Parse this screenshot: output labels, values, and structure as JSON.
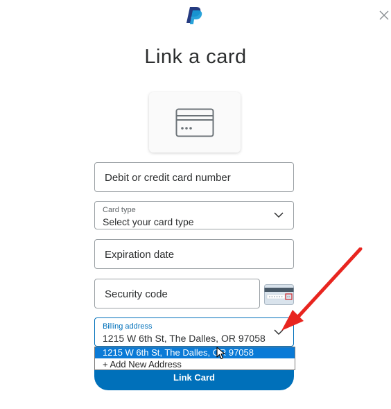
{
  "header": {
    "title": "Link a card",
    "logo_icon": "paypal-logo",
    "close_icon": "close-icon"
  },
  "card_tile": {
    "icon": "credit-card-icon"
  },
  "form": {
    "card_number": {
      "placeholder": "Debit or credit card number"
    },
    "card_type": {
      "label": "Card type",
      "value": "Select your card type"
    },
    "expiration": {
      "placeholder": "Expiration date"
    },
    "security": {
      "placeholder": "Security code",
      "helper_icon": "card-back-cvv-icon"
    },
    "billing": {
      "label": "Billing address",
      "value": "1215 W 6th St, The Dalles, OR 97058",
      "options": [
        "1215 W 6th St, The Dalles, OR 97058",
        "+ Add New Address"
      ],
      "selected_index": 0
    },
    "submit_label": "Link Card"
  },
  "colors": {
    "primary": "#0070ba",
    "paypal_dark": "#253b80",
    "paypal_light": "#179bd7",
    "annotation_arrow": "#e8251f",
    "dropdown_highlight": "#0a7ad6"
  }
}
